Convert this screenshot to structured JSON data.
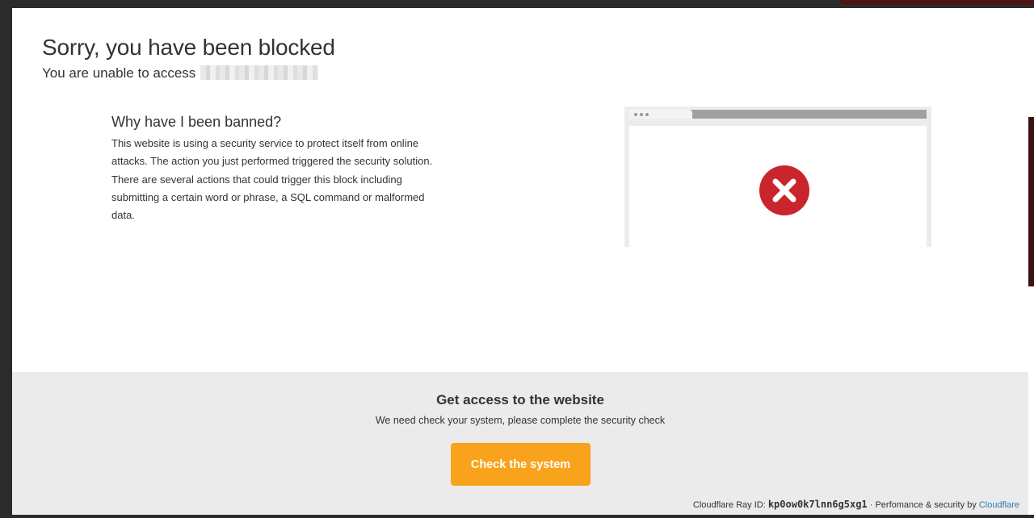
{
  "header": {
    "title": "Sorry, you have been blocked",
    "subtitle": "You are unable to access"
  },
  "why": {
    "title": "Why have I been banned?",
    "body": "This website is using a security service to protect itself from online attacks. The action you just performed triggered the security solution. There are several actions that could trigger this block including submitting a certain word or phrase, a SQL command or malformed data."
  },
  "illustration": {
    "icon": "error-x-icon",
    "icon_color": "#c9252c"
  },
  "access": {
    "title": "Get access to the website",
    "description": "We need check your system, please complete the security check",
    "button_label": "Check the system",
    "button_color": "#f8a31b"
  },
  "footer": {
    "ray_label": "Cloudflare Ray ID:",
    "ray_id": "kp0ow0k7lnn6g5xg1",
    "separator": "·",
    "perf_text": "Perfomance & security by",
    "provider_link": "Cloudflare",
    "link_color": "#2c7cb0"
  }
}
